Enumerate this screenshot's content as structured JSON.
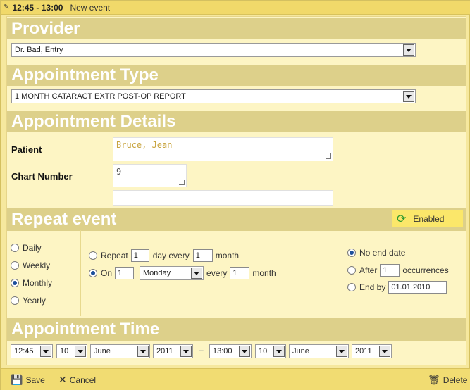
{
  "title": {
    "time": "12:45 - 13:00",
    "event": "New event"
  },
  "provider": {
    "heading": "Provider",
    "selected": "Dr. Bad, Entry"
  },
  "appointment_type": {
    "heading": "Appointment Type",
    "selected": "1 MONTH CATARACT EXTR POST-OP REPORT"
  },
  "details": {
    "heading": "Appointment Details",
    "patient_label": "Patient",
    "patient_value": "Bruce, Jean",
    "chart_label": "Chart Number",
    "chart_value": "9",
    "extra_value": ""
  },
  "repeat": {
    "heading": "Repeat event",
    "enabled_label": "Enabled",
    "frequency": [
      {
        "label": "Daily",
        "selected": false
      },
      {
        "label": "Weekly",
        "selected": false
      },
      {
        "label": "Monthly",
        "selected": true
      },
      {
        "label": "Yearly",
        "selected": false
      }
    ],
    "pattern1": {
      "label": "Repeat",
      "day_value": "1",
      "day_every": "day every",
      "month_value": "1",
      "month": "month"
    },
    "pattern2": {
      "label": "On",
      "on_value": "1",
      "weekday": "Monday",
      "every": "every",
      "month_value": "1",
      "month": "month"
    },
    "end": {
      "no_end_label": "No end date",
      "after_label": "After",
      "after_value": "1",
      "occurrences": "occurrences",
      "end_by_label": "End by",
      "end_by_value": "01.01.2010"
    }
  },
  "time": {
    "heading": "Appointment Time",
    "start": {
      "time": "12:45",
      "day": "10",
      "month": "June",
      "year": "2011"
    },
    "separator": "–",
    "end": {
      "time": "13:00",
      "day": "10",
      "month": "June",
      "year": "2011"
    }
  },
  "footer": {
    "save": "Save",
    "cancel": "Cancel",
    "delete": "Delete"
  }
}
